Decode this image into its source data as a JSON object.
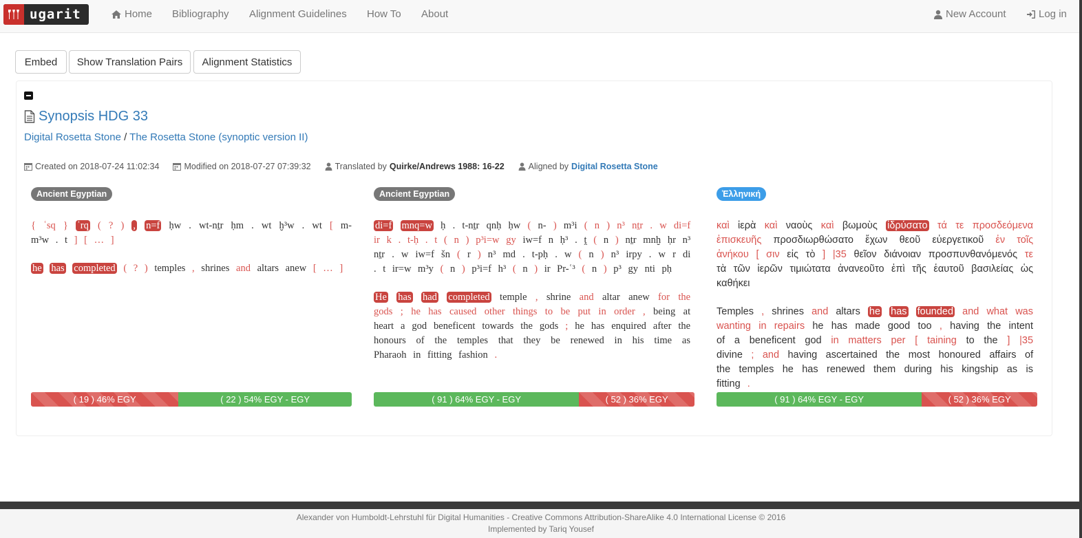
{
  "navbar": {
    "brand": "ugarit",
    "links": {
      "home": "Home",
      "bibliography": "Bibliography",
      "guidelines": "Alignment Guidelines",
      "howto": "How To",
      "about": "About",
      "new_account": "New Account",
      "login": "Log in"
    }
  },
  "toolbar": {
    "embed": "Embed",
    "show_pairs": "Show Translation Pairs",
    "stats": "Alignment Statistics"
  },
  "text": {
    "title": "Synopsis HDG 33",
    "crumb_1": "Digital Rosetta Stone",
    "crumb_sep": "/",
    "crumb_2": "The Rosetta Stone (synoptic version II)",
    "created": "Created on 2018-07-24 11:02:34",
    "modified": "Modified on 2018-07-27 07:39:32",
    "translated_label": "Translated by",
    "translated_by": "Quirke/Andrews 1988: 16-22",
    "aligned_label": "Aligned by",
    "aligned_by": "Digital Rosetta Stone"
  },
  "colors": {
    "highlight": "#c9443f",
    "aligned": "#d9534f",
    "green": "#5cb85c",
    "greek_badge": "#3c9de8"
  },
  "columns": [
    {
      "lang": "Ancient Egyptian",
      "source_tokens": [
        [
          "{",
          "r"
        ],
        [
          "ʿsq",
          "r"
        ],
        [
          "}",
          "r"
        ],
        [
          "ʿrq",
          "h"
        ],
        [
          "(",
          "r"
        ],
        [
          "?",
          "r"
        ],
        [
          ")",
          "r"
        ],
        [
          ",",
          "h"
        ],
        [
          "n=f",
          "h"
        ],
        [
          "ḥw",
          "n"
        ],
        [
          ".",
          "n"
        ],
        [
          "wt-nṯr",
          "n"
        ],
        [
          "ḥm",
          "n"
        ],
        [
          ".",
          "n"
        ],
        [
          "wt",
          "n"
        ],
        [
          "ḫ³w",
          "n"
        ],
        [
          ".",
          "n"
        ],
        [
          "wt",
          "n"
        ],
        [
          "[",
          "r"
        ],
        [
          "m-m³w",
          "n"
        ],
        [
          ".",
          "n"
        ],
        [
          "t",
          "n"
        ],
        [
          "]",
          "r"
        ],
        [
          "[",
          "r"
        ],
        [
          "…",
          "r"
        ],
        [
          "]",
          "r"
        ]
      ],
      "translation_tokens": [
        [
          "he",
          "h"
        ],
        [
          "has",
          "h"
        ],
        [
          "completed",
          "h"
        ],
        [
          "(",
          "r"
        ],
        [
          "?",
          "r"
        ],
        [
          ")",
          "r"
        ],
        [
          "temples",
          "n"
        ],
        [
          ",",
          "r"
        ],
        [
          "shrines",
          "n"
        ],
        [
          "and",
          "r"
        ],
        [
          "altars",
          "n"
        ],
        [
          "anew",
          "n"
        ],
        [
          "[",
          "r"
        ],
        [
          "…",
          "r"
        ],
        [
          "]",
          "r"
        ]
      ],
      "bar": [
        {
          "label": "( 19 ) 46% EGY",
          "type": "red",
          "fraction": 0.46
        },
        {
          "label": "( 22 ) 54% EGY - EGY",
          "type": "green",
          "fraction": 0.54
        }
      ]
    },
    {
      "lang": "Ancient Egyptian",
      "source_tokens": [
        [
          "di=f",
          "h"
        ],
        [
          "mnq=w",
          "h"
        ],
        [
          "ḥ",
          "n"
        ],
        [
          ".",
          "n"
        ],
        [
          "t-nṯr",
          "n"
        ],
        [
          "qnḥ",
          "n"
        ],
        [
          "ḥw",
          "n"
        ],
        [
          "(",
          "r"
        ],
        [
          "n-",
          "n"
        ],
        [
          ")",
          "r"
        ],
        [
          "m³i",
          "n"
        ],
        [
          "(",
          "r"
        ],
        [
          "n",
          "r"
        ],
        [
          ")",
          "r"
        ],
        [
          "n³",
          "r"
        ],
        [
          "nṯr",
          "r"
        ],
        [
          ".",
          "r"
        ],
        [
          "w",
          "r"
        ],
        [
          "di=f",
          "r"
        ],
        [
          "ir",
          "r"
        ],
        [
          "k",
          "r"
        ],
        [
          ".",
          "r"
        ],
        [
          "t-ḥ",
          "r"
        ],
        [
          ".",
          "r"
        ],
        [
          "t",
          "r"
        ],
        [
          "(",
          "r"
        ],
        [
          "n",
          "r"
        ],
        [
          ")",
          "r"
        ],
        [
          "p³i=w",
          "r"
        ],
        [
          "gy",
          "r"
        ],
        [
          "iw=f",
          "n"
        ],
        [
          "n",
          "n"
        ],
        [
          "ḥ³",
          "n"
        ],
        [
          ".",
          "n"
        ],
        [
          "ṱ",
          "n"
        ],
        [
          "(",
          "r"
        ],
        [
          "n",
          "n"
        ],
        [
          ")",
          "r"
        ],
        [
          "nṯr",
          "n"
        ],
        [
          "mnḫ",
          "n"
        ],
        [
          "ḥr",
          "n"
        ],
        [
          "n³",
          "n"
        ],
        [
          "nṯr",
          "n"
        ],
        [
          ".",
          "n"
        ],
        [
          "w",
          "n"
        ],
        [
          "iw=f",
          "n"
        ],
        [
          "šn",
          "n"
        ],
        [
          "(",
          "r"
        ],
        [
          "r",
          "n"
        ],
        [
          ")",
          "r"
        ],
        [
          "n³",
          "n"
        ],
        [
          "md",
          "n"
        ],
        [
          ".",
          "n"
        ],
        [
          "t-pḥ",
          "n"
        ],
        [
          ".",
          "n"
        ],
        [
          "w",
          "n"
        ],
        [
          "(",
          "r"
        ],
        [
          "n",
          "n"
        ],
        [
          ")",
          "r"
        ],
        [
          "n³",
          "n"
        ],
        [
          "irpy",
          "n"
        ],
        [
          ".",
          "n"
        ],
        [
          "w",
          "n"
        ],
        [
          "r",
          "n"
        ],
        [
          "di",
          "n"
        ],
        [
          ".",
          "n"
        ],
        [
          "t",
          "n"
        ],
        [
          "ir=w",
          "n"
        ],
        [
          "m³y",
          "n"
        ],
        [
          "(",
          "r"
        ],
        [
          "n",
          "n"
        ],
        [
          ")",
          "r"
        ],
        [
          "p³i=f",
          "n"
        ],
        [
          "h³",
          "n"
        ],
        [
          "(",
          "r"
        ],
        [
          "n",
          "n"
        ],
        [
          ")",
          "r"
        ],
        [
          "ir",
          "n"
        ],
        [
          "Pr-ʿ³",
          "n"
        ],
        [
          "(",
          "r"
        ],
        [
          "n",
          "n"
        ],
        [
          ")",
          "r"
        ],
        [
          "p³",
          "n"
        ],
        [
          "gy",
          "n"
        ],
        [
          "nti",
          "n"
        ],
        [
          "pḥ",
          "n"
        ]
      ],
      "translation_tokens": [
        [
          "He",
          "h"
        ],
        [
          "has",
          "h"
        ],
        [
          "had",
          "h"
        ],
        [
          "completed",
          "h"
        ],
        [
          "temple",
          "n"
        ],
        [
          ",",
          "r"
        ],
        [
          "shrine",
          "n"
        ],
        [
          "and",
          "r"
        ],
        [
          "altar",
          "n"
        ],
        [
          "anew",
          "n"
        ],
        [
          "for",
          "r"
        ],
        [
          "the",
          "r"
        ],
        [
          "gods",
          "r"
        ],
        [
          ";",
          "r"
        ],
        [
          "he",
          "r"
        ],
        [
          "has",
          "r"
        ],
        [
          "caused",
          "r"
        ],
        [
          "other",
          "r"
        ],
        [
          "things",
          "r"
        ],
        [
          "to",
          "r"
        ],
        [
          "be",
          "r"
        ],
        [
          "put",
          "r"
        ],
        [
          "in",
          "r"
        ],
        [
          "order",
          "r"
        ],
        [
          ",",
          "r"
        ],
        [
          "being",
          "n"
        ],
        [
          "at",
          "n"
        ],
        [
          "heart",
          "n"
        ],
        [
          "a",
          "n"
        ],
        [
          "god",
          "n"
        ],
        [
          "beneficent",
          "n"
        ],
        [
          "towards",
          "n"
        ],
        [
          "the",
          "n"
        ],
        [
          "gods",
          "n"
        ],
        [
          ";",
          "r"
        ],
        [
          "he",
          "n"
        ],
        [
          "has",
          "n"
        ],
        [
          "enquired",
          "n"
        ],
        [
          "after",
          "n"
        ],
        [
          "the",
          "n"
        ],
        [
          "honours",
          "n"
        ],
        [
          "of",
          "n"
        ],
        [
          "the",
          "n"
        ],
        [
          "temples",
          "n"
        ],
        [
          "that",
          "n"
        ],
        [
          "they",
          "n"
        ],
        [
          "be",
          "n"
        ],
        [
          "renewed",
          "n"
        ],
        [
          "in",
          "n"
        ],
        [
          "his",
          "n"
        ],
        [
          "time",
          "n"
        ],
        [
          "as",
          "n"
        ],
        [
          "Pharaoh",
          "n"
        ],
        [
          "in",
          "n"
        ],
        [
          "fitting",
          "n"
        ],
        [
          "fashion",
          "n"
        ],
        [
          ".",
          "r"
        ]
      ],
      "bar": [
        {
          "label": "( 91 ) 64% EGY - EGY",
          "type": "green",
          "fraction": 0.64
        },
        {
          "label": "( 52 ) 36% EGY",
          "type": "red",
          "fraction": 0.36
        }
      ]
    },
    {
      "lang": "Ἑλληνική",
      "source_tokens": [
        [
          "καὶ",
          "r"
        ],
        [
          "ἱερὰ",
          "n"
        ],
        [
          "καὶ",
          "r"
        ],
        [
          "ναοὺς",
          "n"
        ],
        [
          "καὶ",
          "r"
        ],
        [
          "βωμοὺς",
          "n"
        ],
        [
          "ἱδρύσατο",
          "h"
        ],
        [
          "τά",
          "r"
        ],
        [
          "τε",
          "r"
        ],
        [
          "προσδεόμενα",
          "r"
        ],
        [
          "ἐπισκευῆς",
          "r"
        ],
        [
          "προσδιωρθώσατο",
          "n"
        ],
        [
          "ἔχων",
          "n"
        ],
        [
          "θεοῦ",
          "n"
        ],
        [
          "εὐεργετικοῦ",
          "n"
        ],
        [
          "ἐν",
          "r"
        ],
        [
          "τοῖς",
          "r"
        ],
        [
          "ἀνήκου",
          "r"
        ],
        [
          "[",
          "r"
        ],
        [
          "σιν",
          "r"
        ],
        [
          "εἰς",
          "n"
        ],
        [
          "τὸ",
          "n"
        ],
        [
          "]",
          "r"
        ],
        [
          "|35",
          "r"
        ],
        [
          "θεῖον",
          "n"
        ],
        [
          "διάνοιαν",
          "n"
        ],
        [
          "προσπυνθανόμενός",
          "n"
        ],
        [
          "τε",
          "r"
        ],
        [
          "τὰ",
          "n"
        ],
        [
          "τῶν",
          "n"
        ],
        [
          "ἱερῶν",
          "n"
        ],
        [
          "τιμιώτατα",
          "n"
        ],
        [
          "ἀνανεοῦτο",
          "n"
        ],
        [
          "ἐπὶ",
          "n"
        ],
        [
          "τῆς",
          "n"
        ],
        [
          "ἑαυτοῦ",
          "n"
        ],
        [
          "βασιλείας",
          "n"
        ],
        [
          "ὡς",
          "n"
        ],
        [
          "καθήκει",
          "n"
        ]
      ],
      "translation_tokens": [
        [
          "Temples",
          "n"
        ],
        [
          ",",
          "r"
        ],
        [
          "shrines",
          "n"
        ],
        [
          "and",
          "r"
        ],
        [
          "altars",
          "n"
        ],
        [
          "he",
          "h"
        ],
        [
          "has",
          "h"
        ],
        [
          "founded",
          "h"
        ],
        [
          "and",
          "r"
        ],
        [
          "what",
          "r"
        ],
        [
          "was",
          "r"
        ],
        [
          "wanting",
          "r"
        ],
        [
          "in",
          "r"
        ],
        [
          "repairs",
          "r"
        ],
        [
          "he",
          "n"
        ],
        [
          "has",
          "n"
        ],
        [
          "made",
          "n"
        ],
        [
          "good",
          "n"
        ],
        [
          "too",
          "n"
        ],
        [
          ",",
          "r"
        ],
        [
          "having",
          "n"
        ],
        [
          "the",
          "n"
        ],
        [
          "intent",
          "n"
        ],
        [
          "of",
          "n"
        ],
        [
          "a",
          "n"
        ],
        [
          "beneficent",
          "n"
        ],
        [
          "god",
          "n"
        ],
        [
          "in",
          "r"
        ],
        [
          "matters",
          "r"
        ],
        [
          "per",
          "r"
        ],
        [
          "[",
          "r"
        ],
        [
          "taining",
          "r"
        ],
        [
          "to",
          "n"
        ],
        [
          "the",
          "n"
        ],
        [
          "]",
          "r"
        ],
        [
          "|35",
          "r"
        ],
        [
          "divine",
          "n"
        ],
        [
          ";",
          "r"
        ],
        [
          "and",
          "r"
        ],
        [
          "having",
          "n"
        ],
        [
          "ascertained",
          "n"
        ],
        [
          "the",
          "n"
        ],
        [
          "most",
          "n"
        ],
        [
          "honoured",
          "n"
        ],
        [
          "affairs",
          "n"
        ],
        [
          "of",
          "n"
        ],
        [
          "the",
          "n"
        ],
        [
          "temples",
          "n"
        ],
        [
          "he",
          "n"
        ],
        [
          "has",
          "n"
        ],
        [
          "renewed",
          "n"
        ],
        [
          "them",
          "n"
        ],
        [
          "during",
          "n"
        ],
        [
          "his",
          "n"
        ],
        [
          "kingship",
          "n"
        ],
        [
          "as",
          "n"
        ],
        [
          "is",
          "n"
        ],
        [
          "fitting",
          "n"
        ],
        [
          ".",
          "r"
        ]
      ],
      "bar": [
        {
          "label": "( 91 ) 64% EGY - EGY",
          "type": "green",
          "fraction": 0.64
        },
        {
          "label": "( 52 ) 36% EGY",
          "type": "red",
          "fraction": 0.36
        }
      ]
    }
  ],
  "footer": {
    "line1": "Alexander von Humboldt-Lehrstuhl für Digital Humanities - Creative Commons Attribution-ShareAlike 4.0 International License © 2016",
    "line2": "Implemented by Tariq Yousef"
  }
}
